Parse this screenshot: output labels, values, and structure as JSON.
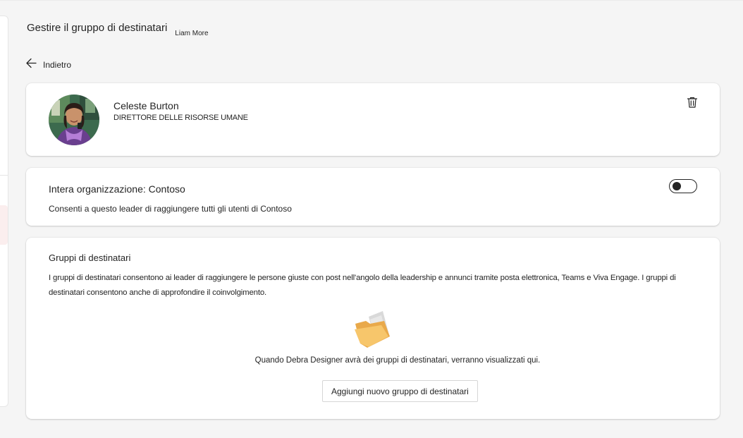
{
  "header": {
    "title": "Gestire il gruppo di destinatari",
    "user": "Liam More"
  },
  "back": {
    "label": "Indietro"
  },
  "person": {
    "name": "Celeste Burton",
    "role": "DIRETTORE DELLE RISORSE UMANE"
  },
  "organization": {
    "label": "Intera organizzazione: Contoso",
    "description": "Consenti a questo leader di raggiungere tutti gli utenti di Contoso",
    "toggle_on": false
  },
  "groups": {
    "title": "Gruppi di destinatari",
    "description": "I gruppi di destinatari consentono ai leader di raggiungere le persone giuste con post nell'angolo della leadership e annunci tramite posta elettronica, Teams e Viva Engage. I gruppi di destinatari consentono anche di approfondire il coinvolgimento.",
    "empty_message": "Quando Debra Designer avrà dei gruppi di destinatari, verranno visualizzati qui.",
    "add_button": "Aggiungi nuovo gruppo di destinatari"
  },
  "colors": {
    "background": "#f5f5f5",
    "card": "#ffffff",
    "text": "#242424",
    "folder": "#f7c66b"
  },
  "icons": {
    "back": "arrow-left-icon",
    "delete": "trash-icon",
    "empty": "folder-icon"
  }
}
